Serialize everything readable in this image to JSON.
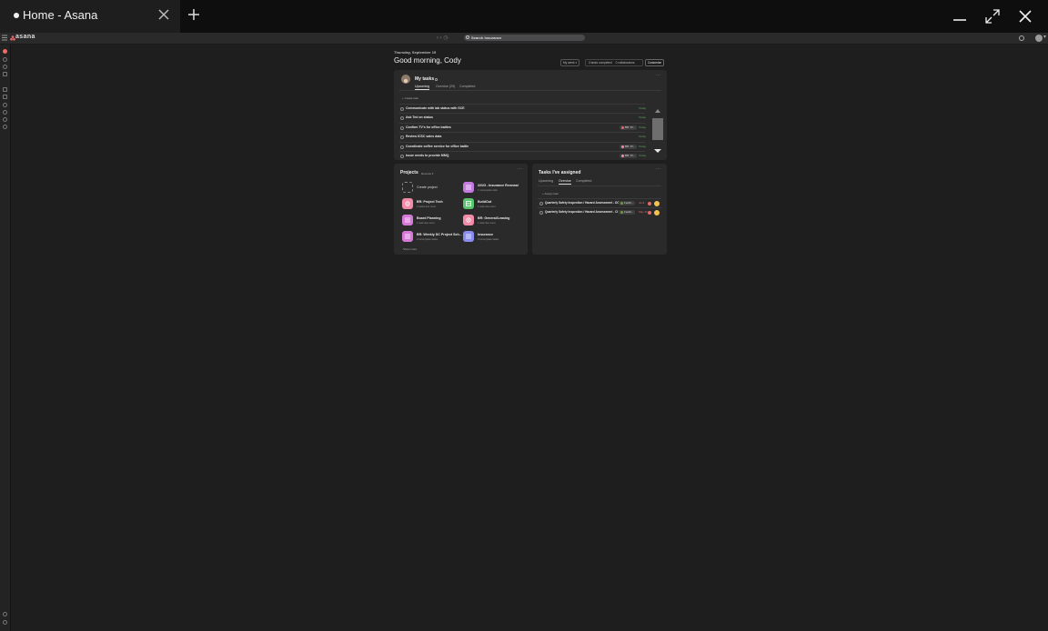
{
  "window": {
    "tab_title": "Home - Asana",
    "new_tab": "+"
  },
  "topbar": {
    "logo": "asana",
    "search_placeholder": "Search Insurance"
  },
  "main": {
    "date": "Thursday, September 15",
    "greeting": "Good morning, Cody",
    "my_week": "My week ▾",
    "stats": {
      "completed": "0 tasks completed",
      "collaborators": "0 collaborators"
    },
    "customize": "Customize"
  },
  "my_tasks": {
    "title": "My tasks",
    "tabs": [
      "Upcoming",
      "Overdue (29)",
      "Completed"
    ],
    "create_task": "+ Create task",
    "tasks": [
      {
        "text": "Communicate with lab status with SCE",
        "tag": "",
        "due": "Today"
      },
      {
        "text": "Ask Ted on status",
        "tag": "",
        "due": "Today"
      },
      {
        "text": "Confirm TV's for office battles",
        "tag": "BR: Pr...",
        "due": "Today"
      },
      {
        "text": "Review ICSC sales data",
        "tag": "",
        "due": "Today"
      },
      {
        "text": "Coordinate coffee service for office battle",
        "tag": "BR: Pr...",
        "due": "Today"
      },
      {
        "text": "Issue needs to provide MMQ",
        "tag": "BR: Pr...",
        "due": "Today"
      }
    ]
  },
  "projects": {
    "title": "Projects",
    "recents": "Recents ▾",
    "show_more": "Show more",
    "items": [
      {
        "name": "Create project",
        "sub": "",
        "color": ""
      },
      {
        "name": "22/23 - Insurance Renewal",
        "sub": "1 incomplete task",
        "color": "#c47be0"
      },
      {
        "name": "BR: Project Tech",
        "sub": "2 tasks due soon",
        "color": "#f28ba8"
      },
      {
        "name": "BuildOut",
        "sub": "1 task due soon",
        "color": "#5cc36e"
      },
      {
        "name": "Board Planning",
        "sub": "1 task due soon",
        "color": "#d67ad9"
      },
      {
        "name": "BR: General/Leasing",
        "sub": "1 task due soon",
        "color": "#f28ba8"
      },
      {
        "name": "BR: Weekly DC Project Sch...",
        "sub": "2 incomplete tasks",
        "color": "#d67ad9"
      },
      {
        "name": "Insurance",
        "sub": "3 incomplete tasks",
        "color": "#8a8df0"
      }
    ]
  },
  "assigned": {
    "title": "Tasks I've assigned",
    "tabs": [
      "Upcoming",
      "Overdue",
      "Completed"
    ],
    "assign_task": "+ Assign task",
    "tasks": [
      {
        "text": "Quarterly Safety Inspection / Hazard Assessment - DC1",
        "tag": "Facilit...",
        "date": "Jul 8"
      },
      {
        "text": "Quarterly Safety Inspection / Hazard Assessment - CI",
        "tag": "Facilit...",
        "date": "May 31"
      }
    ]
  },
  "colors": {
    "background": "#1e1e1f",
    "card": "#2a2a2b",
    "brand": "#f06a6a",
    "due_today": "#5aa95d",
    "overdue": "#e06a6a"
  }
}
